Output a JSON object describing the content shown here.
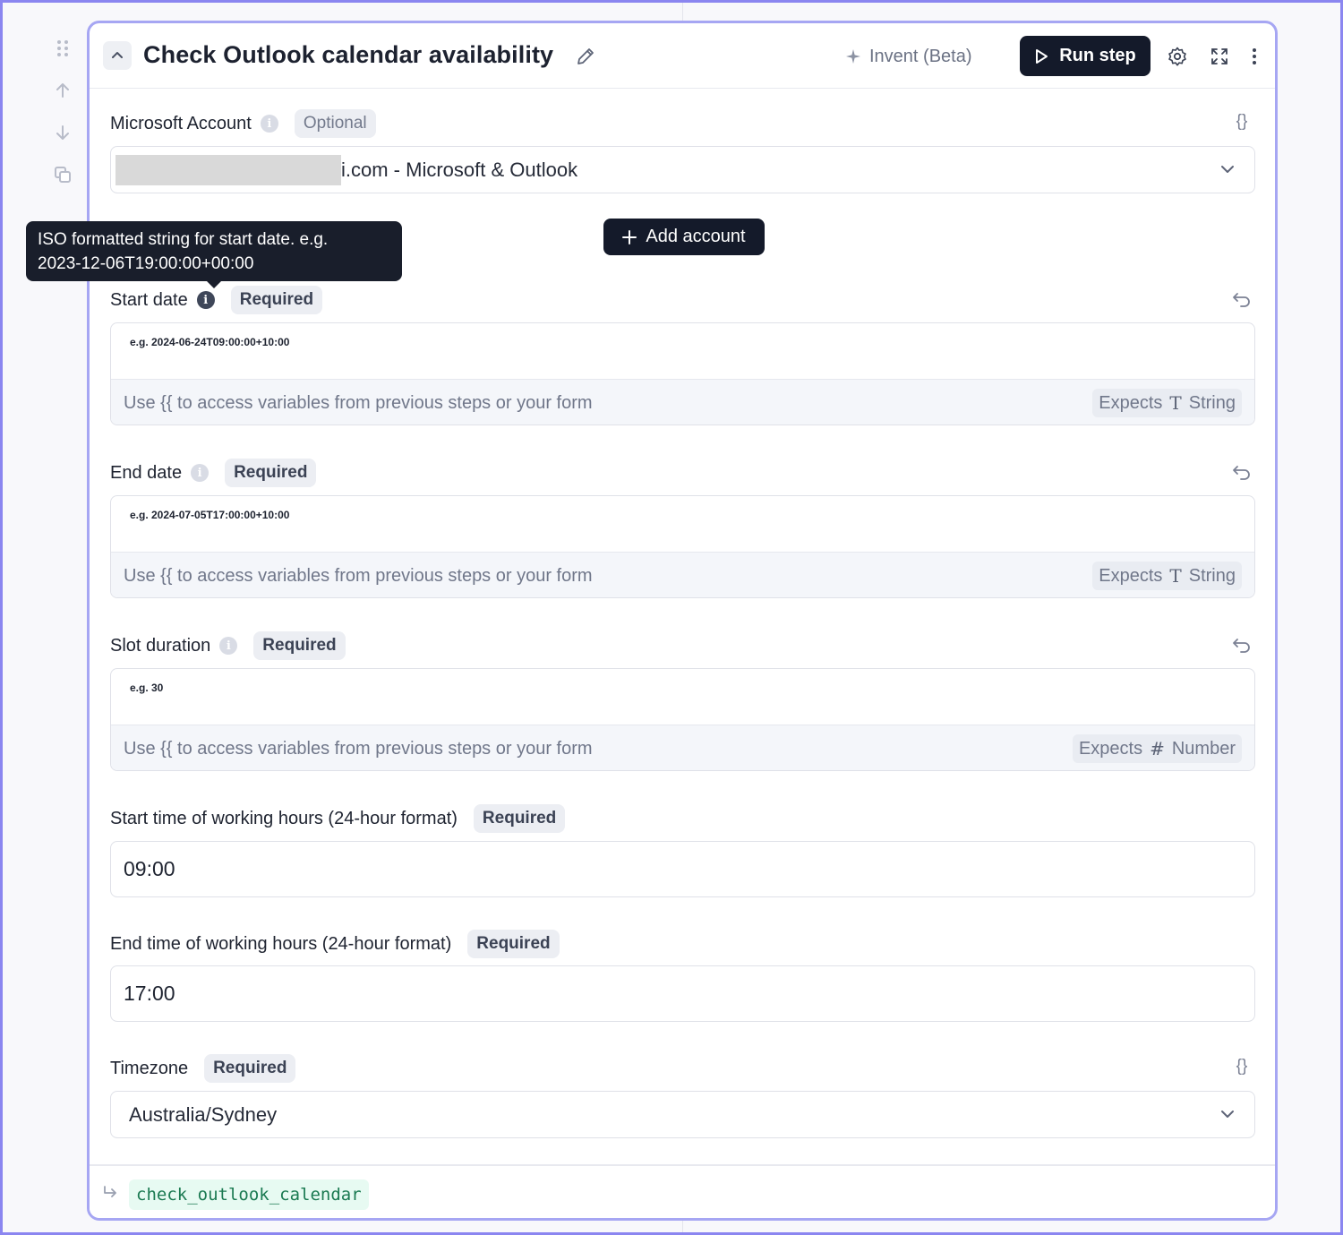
{
  "step": {
    "title": "Check Outlook calendar availability",
    "invent_label": "Invent (Beta)",
    "run_label": "Run step",
    "output_variable": "check_outlook_calendar"
  },
  "account": {
    "label": "Microsoft Account",
    "badge": "Optional",
    "value": "i.com - Microsoft & Outlook",
    "add_account_label": "Add account"
  },
  "tooltip": {
    "text_line1": "ISO formatted string for start date. e.g.",
    "text_line2": "2023-12-06T19:00:00+00:00"
  },
  "hint": "Use {{ to access variables from previous steps or your form",
  "expects_label": "Expects",
  "fields": [
    {
      "label": "Start date",
      "badge": "Required",
      "placeholder": "e.g. 2024-06-24T09:00:00+10:00",
      "type": "String"
    },
    {
      "label": "End date",
      "badge": "Required",
      "placeholder": "e.g. 2024-07-05T17:00:00+10:00",
      "type": "String"
    },
    {
      "label": "Slot duration",
      "badge": "Required",
      "placeholder": "e.g. 30",
      "type": "Number"
    }
  ],
  "working_hours": {
    "start": {
      "label": "Start time of working hours (24-hour format)",
      "badge": "Required",
      "value": "09:00"
    },
    "end": {
      "label": "End time of working hours (24-hour format)",
      "badge": "Required",
      "value": "17:00"
    }
  },
  "timezone": {
    "label": "Timezone",
    "badge": "Required",
    "value": "Australia/Sydney"
  },
  "colors": {
    "accent_border": "#a6a6f3",
    "run_button": "#141a2a",
    "variable_chip_bg": "#e7faf2",
    "variable_chip_text": "#1b7a52"
  }
}
